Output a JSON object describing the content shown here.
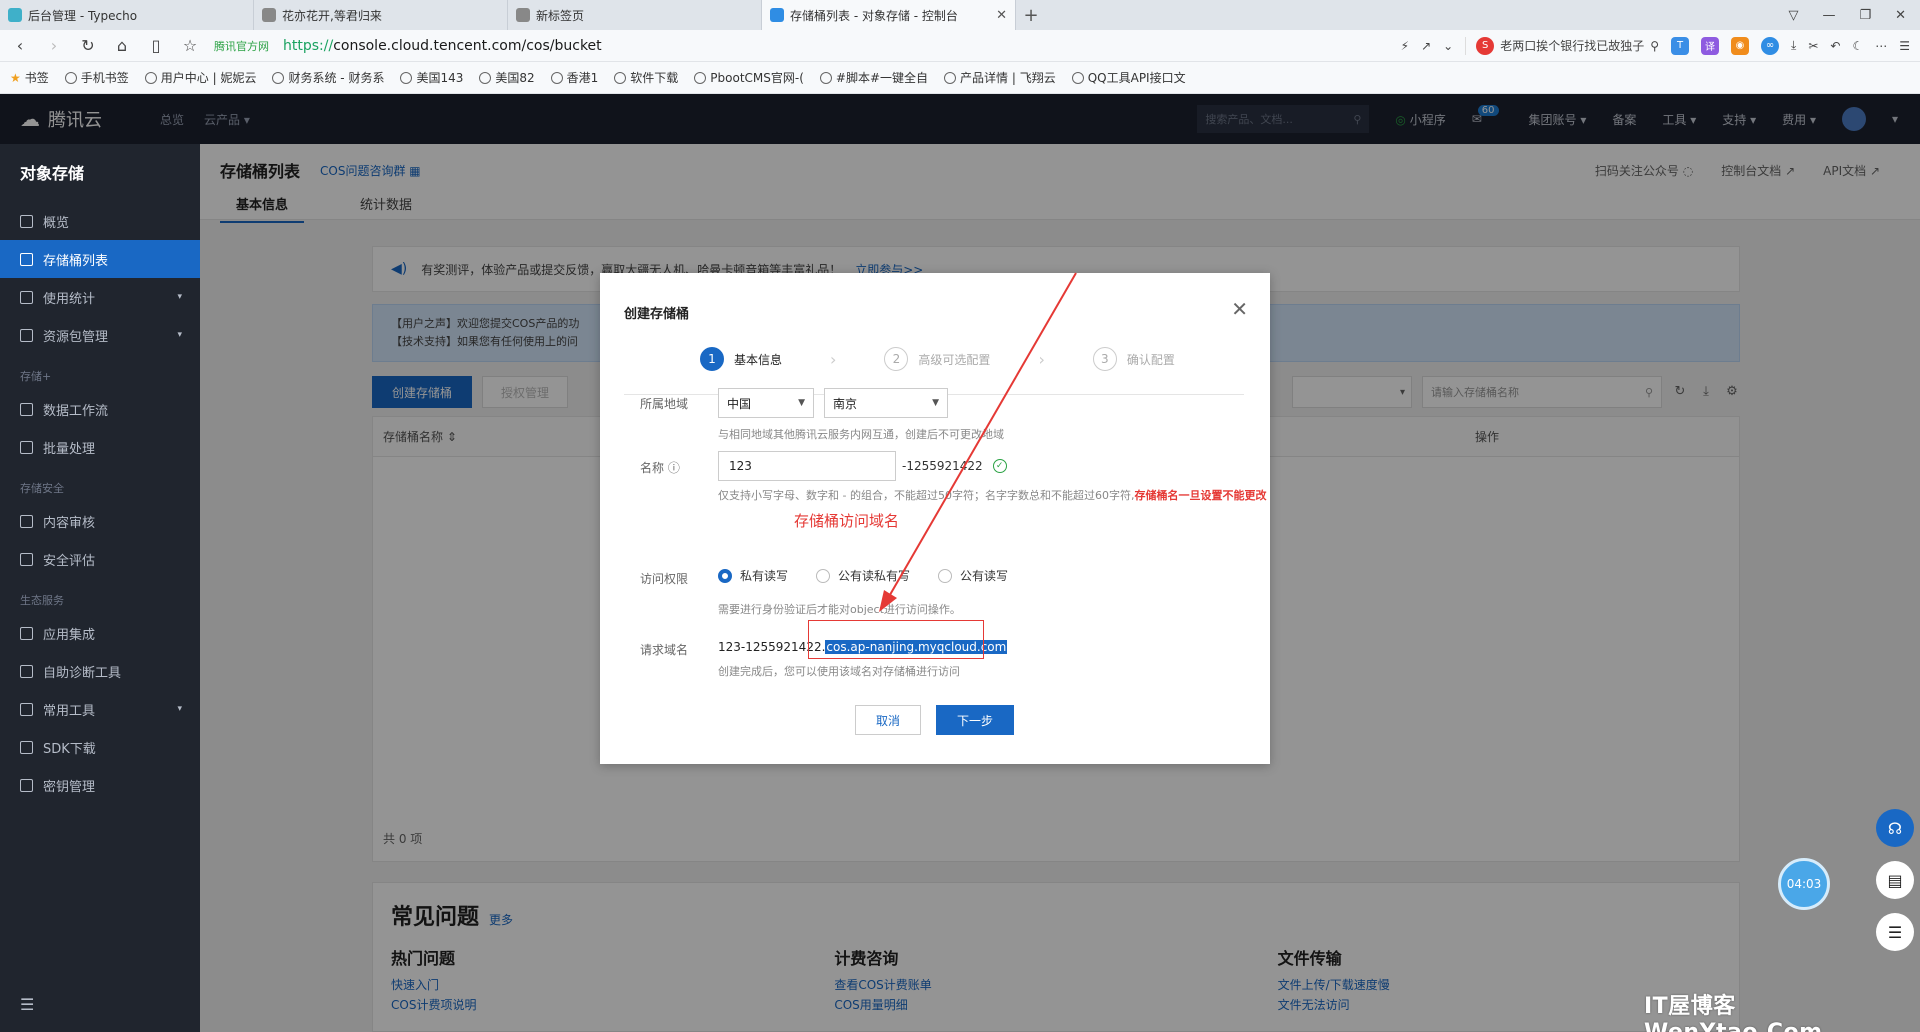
{
  "browser": {
    "tabs": [
      {
        "title": "后台管理 - Typecho",
        "color": "#3fb0c9"
      },
      {
        "title": "花亦花开,等君归来",
        "color": "#888888"
      },
      {
        "title": "新标签页",
        "color": "#888888"
      },
      {
        "title": "存储桶列表 - 对象存储 - 控制台",
        "color": "#2f8de4",
        "active": true
      }
    ],
    "url_scheme": "https://",
    "url_rest": "console.cloud.tencent.com/cos/bucket",
    "site_tag": "腾讯官方网",
    "search_text": "老两口挨个银行找已故独子",
    "bookmarks": [
      "书签",
      "手机书签",
      "用户中心 | 妮妮云",
      "财务系统 - 财务系",
      "美国143",
      "美国82",
      "香港1",
      "软件下载",
      "PbootCMS官网-(",
      "#脚本#一键全自",
      "产品详情 | 飞翔云",
      "QQ工具API接口文"
    ]
  },
  "topnav": {
    "logo": "腾讯云",
    "items": [
      "总览",
      "云产品"
    ],
    "search_placeholder": "搜索产品、文档...",
    "right": [
      "小程序",
      "集团账号",
      "备案",
      "工具",
      "支持",
      "费用"
    ],
    "badge": "60"
  },
  "sidebar": {
    "title": "对象存储",
    "items": [
      {
        "label": "概览"
      },
      {
        "label": "存储桶列表",
        "active": true
      },
      {
        "label": "使用统计",
        "arrow": true
      },
      {
        "label": "资源包管理",
        "arrow": true
      }
    ],
    "group_storage": "存储+",
    "storage_items": [
      {
        "label": "数据工作流"
      },
      {
        "label": "批量处理"
      }
    ],
    "group_security": "存储安全",
    "security_items": [
      {
        "label": "内容审核"
      },
      {
        "label": "安全评估"
      }
    ],
    "group_eco": "生态服务",
    "eco_items": [
      {
        "label": "应用集成"
      },
      {
        "label": "自助诊断工具"
      },
      {
        "label": "常用工具",
        "arrow": true
      },
      {
        "label": "SDK下载"
      },
      {
        "label": "密钥管理"
      }
    ]
  },
  "page": {
    "title": "存储桶列表",
    "cos_group": "COS问题咨询群",
    "tabs": [
      "基本信息",
      "统计数据"
    ],
    "head_links": [
      "扫码关注公众号",
      "控制台文档",
      "API文档"
    ],
    "banner1": "有奖测评，体验产品或提交反馈，赢取大疆无人机、哈曼卡顿音箱等丰富礼品！",
    "banner1_link": "立即参与>>",
    "banner2_line1": "【用户之声】欢迎您提交COS产品的功",
    "banner2_line2": "【技术支持】如果您有任何使用上的问",
    "create_btn": "创建存储桶",
    "auth_btn": "授权管理",
    "search_placeholder": "请输入存储桶名称",
    "col_name": "存储桶名称",
    "col_op": "操作",
    "total": "共 0 项",
    "faq_title": "常见问题",
    "faq_more": "更多",
    "faq_cols": [
      {
        "title": "热门问题",
        "links": [
          "快速入门",
          "COS计费项说明"
        ]
      },
      {
        "title": "计费咨询",
        "links": [
          "查看COS计费账单",
          "COS用量明细"
        ]
      },
      {
        "title": "文件传输",
        "links": [
          "文件上传/下载速度慢",
          "文件无法访问"
        ]
      }
    ]
  },
  "dialog": {
    "title": "创建存储桶",
    "steps": [
      {
        "num": "1",
        "label": "基本信息",
        "active": true
      },
      {
        "num": "2",
        "label": "高级可选配置"
      },
      {
        "num": "3",
        "label": "确认配置"
      }
    ],
    "region_label": "所属地域",
    "region_country": "中国",
    "region_city": "南京",
    "region_hint": "与相同地域其他腾讯云服务内网互通，创建后不可更改地域",
    "name_label": "名称",
    "name_value": "123",
    "name_suffix": "-1255921422",
    "name_hint": "仅支持小写字母、数字和 - 的组合，不能超过50字符；名字字数总和不能超过60字符,",
    "name_warn": "存储桶名一旦设置不能更改",
    "access_label": "访问权限",
    "access_options": [
      {
        "label": "私有读写",
        "checked": true
      },
      {
        "label": "公有读私有写"
      },
      {
        "label": "公有读写"
      }
    ],
    "access_hint": "需要进行身份验证后才能对object进行访问操作。",
    "domain_label": "请求域名",
    "domain_prefix": "123-1255921422.",
    "domain_highlight": "cos.ap-nanjing.myqcloud.com",
    "domain_hint": "创建完成后，您可以使用该域名对存储桶进行访问",
    "cancel": "取消",
    "next": "下一步"
  },
  "annotation": {
    "text": "存储桶访问域名",
    "color": "#e53935"
  },
  "floating": {
    "timer": "04:03"
  },
  "watermark": "IT屋博客 WenYtao.Com"
}
